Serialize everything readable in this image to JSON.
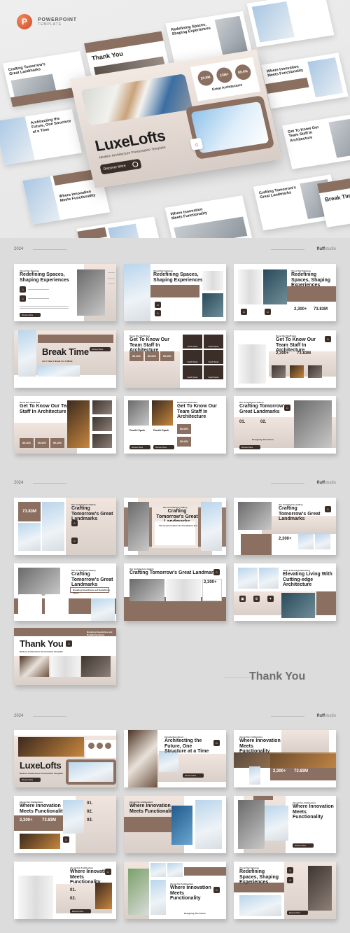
{
  "header": {
    "logo_icon": "powerpoint-icon",
    "logo_letter": "P",
    "logo_line1": "POWERPOINT",
    "logo_line2": "TEMPLATE"
  },
  "hero": {
    "title": "LuxeLofts",
    "subtitle": "Modern Architecture Presentation Template",
    "button_label": "Discover More",
    "stats": [
      "20.5M",
      "13M+",
      "89.4%"
    ],
    "stats_label": "Great Architecture",
    "background_cards": [
      "Crafting Tomorrow's Great Landmarks",
      "Thank You",
      "Redefining Spaces, Shaping Experiences",
      "Architecting the Future, One Structure at a Time",
      "Where Innovation Meets Functionality",
      "Get To Know Our Team Staff In Architecture",
      "Break Time"
    ]
  },
  "sections": [
    {
      "year": "2024",
      "brand_bold": "fluff",
      "brand_rest": "studio"
    },
    {
      "year": "2024",
      "brand_bold": "fluff",
      "brand_rest": "studio"
    },
    {
      "year": "2024",
      "brand_bold": "fluff",
      "brand_rest": "studio"
    }
  ],
  "colors": {
    "accent": "#8b6f60",
    "dark": "#3b2e28",
    "background": "#dcdcdc"
  },
  "slides1": [
    {
      "eyebrow": "About Our Services",
      "title": "Redefining Spaces, Shaping Experiences",
      "button": "Discover More"
    },
    {
      "eyebrow": "About Our Services",
      "title": "Redefining Spaces, Shaping Experiences"
    },
    {
      "eyebrow": "About Our Services",
      "title": "Redefining Spaces, Shaping Experiences",
      "stat1": "2,300+",
      "stat2": "73.83M"
    },
    {
      "title": "Break Time",
      "subtitle": "Let's Take A Break For A While",
      "button": "Discover More"
    },
    {
      "eyebrow": "Know Our Staff Here",
      "title": "Get To Know Our Team Staff In Architecture",
      "stats": [
        "89.43%",
        "89.43%",
        "89.43%"
      ],
      "person": "Fandhi Spark"
    },
    {
      "eyebrow": "Know Our Staff Here",
      "title": "Get To Know Our Team Staff In Architecture",
      "stat1": "2,300+",
      "stat2": "73.83M",
      "person": "Fandhi Spark"
    },
    {
      "eyebrow": "Know Our Staff Here",
      "title": "Get To Know Our Team Staff In Architecture",
      "stats": [
        "89.43%",
        "89.43%",
        "89.43%"
      ]
    },
    {
      "eyebrow": "Know Our Staff Here",
      "title": "Get To Know Our Team Staff In Architecture",
      "stats": [
        "89.43%",
        "89.43%"
      ],
      "person": "Fandhi Spark",
      "button": "Discover More"
    },
    {
      "eyebrow": "Our Architecture Gallery",
      "title": "Crafting Tomorrow's Great Landmarks",
      "num1": "01.",
      "num2": "02.",
      "caption": "Designing The Future",
      "button": "Discover More"
    }
  ],
  "slides2": [
    {
      "eyebrow": "Our Architecture Gallery",
      "title": "Crafting Tomorrow's Great Landmarks",
      "stat": "73.83M"
    },
    {
      "eyebrow": "Our Architecture Gallery",
      "title": "Crafting Tomorrow's Great Landmarks",
      "box_title": "The Great Architect In The Modern Era"
    },
    {
      "eyebrow": "Our Architecture Gallery",
      "title": "Crafting Tomorrow's Great Landmarks",
      "stat": "2,300+"
    },
    {
      "eyebrow": "Our Architecture Gallery",
      "title": "Crafting Tomorrow's Great Landmarks",
      "tag": "Breaking Boundaries and Redefining Space"
    },
    {
      "eyebrow": "Our Architecture Gallery",
      "title": "Crafting Tomorrow's Great Landmarks",
      "stat": "2,300+"
    },
    {
      "eyebrow": "Ideas & Result Architecture",
      "title": "Elevating Living With Cutting-edge Architecture"
    },
    {
      "title": "Thank You",
      "subtitle": "Modern Architecture Presentation Template",
      "tag": "Breaking Boundaries and Redefining Space"
    }
  ],
  "thank_you": "Thank You",
  "slides3": [
    {
      "title": "LuxeLofts",
      "subtitle": "Modern Architecture Presentation Template",
      "button": "Discover More"
    },
    {
      "eyebrow": "Introduction About",
      "title": "Architecting the Future, One Structure at a Time",
      "button": "Discover More"
    },
    {
      "eyebrow": "About Our Architecture",
      "title": "Where Innovation Meets Functionality",
      "stat1": "2,300+",
      "stat2": "73.83M"
    },
    {
      "eyebrow": "About Our Architecture",
      "title": "Where Innovation Meets Functionality",
      "stat1": "2,300+",
      "stat2": "73.83M",
      "nums": [
        "01.",
        "02.",
        "03."
      ]
    },
    {
      "eyebrow": "About Our Architecture",
      "title": "Where Innovation Meets Functionality"
    },
    {
      "eyebrow": "About Our Architecture",
      "title": "Where Innovation Meets Functionality",
      "button": "Discover More"
    },
    {
      "eyebrow": "About Our Architecture",
      "title": "Where Innovation Meets Functionality",
      "nums": [
        "01.",
        "02."
      ],
      "button": "Discover More"
    },
    {
      "eyebrow": "About Our Architecture",
      "title": "Where Innovation Meets Functionality",
      "caption": "Designing The Future"
    },
    {
      "eyebrow": "About Our Services",
      "title": "Redefining Spaces, Shaping Experiences",
      "button": "Discover More"
    }
  ]
}
